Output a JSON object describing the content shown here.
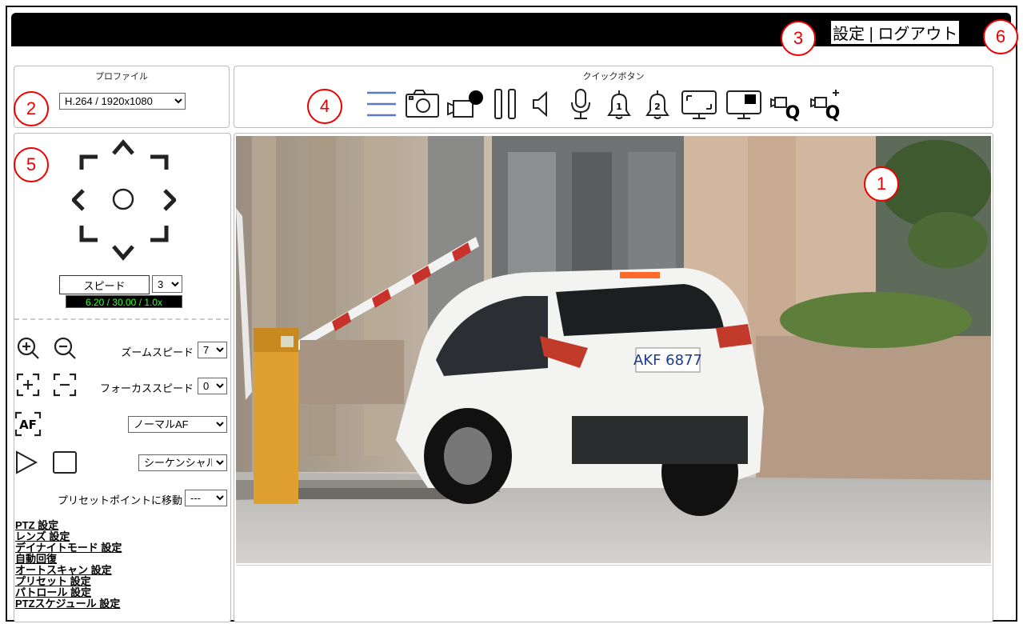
{
  "header": {
    "settings_link": "設定",
    "separator": "|",
    "logout_link": "ログアウト"
  },
  "badges": [
    "1",
    "2",
    "3",
    "4",
    "5",
    "6"
  ],
  "profile": {
    "title": "プロファイル",
    "selected": "H.264 / 1920x1080"
  },
  "quick": {
    "title": "クイックボタン",
    "icons": [
      "menu-icon",
      "camera-snapshot-icon",
      "record-icon",
      "pause-icon",
      "speaker-icon",
      "microphone-icon",
      "alarm-1-icon",
      "alarm-2-icon",
      "fullscreen-icon",
      "monitor-icon",
      "zoom-q-icon",
      "zoom-q-add-icon"
    ]
  },
  "ptz": {
    "speed_label": "スピード",
    "speed_value": "3",
    "readout": "6.20 / 30.00 / 1.0x",
    "zoom_speed_label": "ズームスピード",
    "zoom_speed_value": "7",
    "focus_speed_label": "フォーカススピード",
    "focus_speed_value": "0",
    "af_mode": "ノーマルAF",
    "scan_mode": "シーケンシャル",
    "preset_label": "プリセットポイントに移動",
    "preset_value": "---"
  },
  "links": [
    "PTZ 設定",
    "レンズ 設定",
    "デイナイトモード 設定",
    "自動回復",
    "オートスキャン 設定",
    "プリセット 設定",
    "パトロール 設定",
    "PTZスケジュール 設定"
  ],
  "video": {
    "plate": "AKF 6877"
  },
  "colors": {
    "badge": "#e00000",
    "icon_blue": "#5b78c8",
    "readout_text": "#33ff33"
  }
}
